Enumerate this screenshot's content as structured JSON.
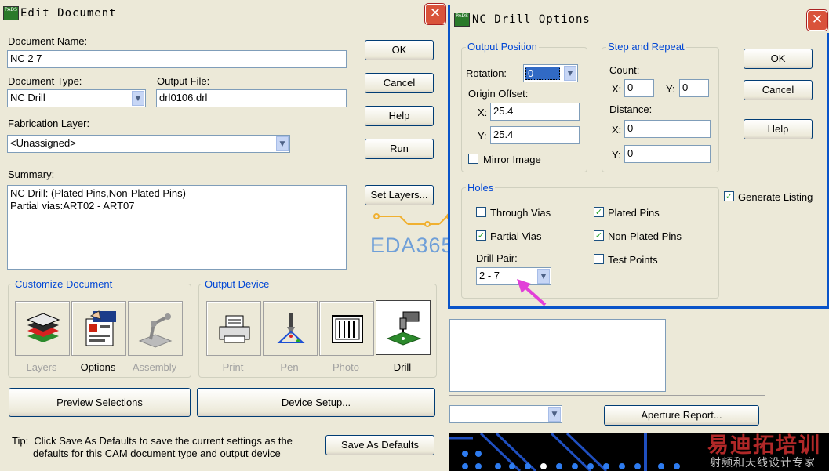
{
  "edit_document": {
    "title": "Edit Document",
    "document_name_label": "Document Name:",
    "document_name_value": "NC 2 7",
    "document_type_label": "Document Type:",
    "document_type_value": "NC Drill",
    "output_file_label": "Output File:",
    "output_file_value": "drl0106.drl",
    "fabrication_layer_label": "Fabrication Layer:",
    "fabrication_layer_value": "<Unassigned>",
    "summary_label": "Summary:",
    "summary_line1": "NC Drill: (Plated Pins,Non-Plated Pins)",
    "summary_line2": "Partial vias:ART02 - ART07",
    "buttons": {
      "ok": "OK",
      "cancel": "Cancel",
      "help": "Help",
      "run": "Run",
      "set_layers": "Set Layers..."
    },
    "customize_title": "Customize Document",
    "customize_items": [
      "Layers",
      "Options",
      "Assembly"
    ],
    "output_device_title": "Output Device",
    "output_devices": [
      "Print",
      "Pen",
      "Photo",
      "Drill"
    ],
    "preview_selections": "Preview Selections",
    "device_setup": "Device Setup...",
    "tip_line1": "Tip:  Click Save As Defaults to save the current settings as the",
    "tip_line2": "defaults for this CAM document type and output device",
    "save_as_defaults": "Save As Defaults"
  },
  "nc_drill": {
    "title": "NC Drill Options",
    "output_position_title": "Output Position",
    "rotation_label": "Rotation:",
    "rotation_value": "0",
    "origin_offset_label": "Origin Offset:",
    "x_label": "X:",
    "y_label": "Y:",
    "origin_x": "25.4",
    "origin_y": "25.4",
    "mirror_image": "Mirror Image",
    "step_repeat_title": "Step and Repeat",
    "count_label": "Count:",
    "count_x": "0",
    "count_y": "0",
    "distance_label": "Distance:",
    "distance_x": "0",
    "distance_y": "0",
    "holes_title": "Holes",
    "through_vias": "Through Vias",
    "partial_vias": "Partial Vias",
    "plated_pins": "Plated Pins",
    "non_plated_pins": "Non-Plated Pins",
    "test_points": "Test Points",
    "drill_pair_label": "Drill Pair:",
    "drill_pair_value": "2 - 7",
    "generate_listing": "Generate Listing",
    "ok": "OK",
    "cancel": "Cancel",
    "help": "Help",
    "checkbox_states": {
      "mirror_image": false,
      "through_vias": false,
      "partial_vias": true,
      "plated_pins": true,
      "non_plated_pins": true,
      "test_points": false,
      "generate_listing": true
    }
  },
  "background": {
    "aperture_report": "Aperture Report..."
  },
  "watermark": {
    "eda": "EDA365",
    "cn1": "易迪拓培训",
    "cn2": "射频和天线设计专家"
  },
  "colors": {
    "title_blue": "#0046d5",
    "check_green": "#21a121",
    "arrow_magenta": "#e23fd8",
    "window_border": "#0a54c9"
  }
}
